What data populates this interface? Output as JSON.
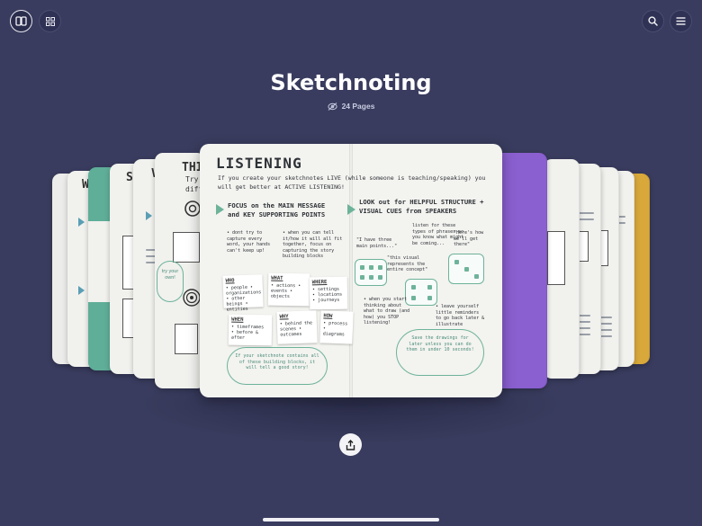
{
  "toolbar": {
    "left": [
      {
        "icon": "book-icon"
      },
      {
        "icon": "grid-icon"
      }
    ],
    "right": [
      {
        "icon": "search-icon"
      },
      {
        "icon": "menu-icon"
      }
    ]
  },
  "notebook": {
    "title": "Sketchnoting",
    "page_count_label": "24 Pages",
    "page_count_icon": "hidden-eye-icon"
  },
  "spread": {
    "title": "LISTENING",
    "intro": "If you create your sketchnotes LIVE (while someone is teaching/speaking) you will get better at ACTIVE LISTENING!",
    "left_heading": "FOCUS on the MAIN MESSAGE and KEY SUPPORTING POINTS",
    "left_note_1": "• dont try to capture every word, your hands can't keep up!",
    "left_note_2": "• when you can tell it/how it will all fit together, focus on capturing the story building blocks",
    "cards": [
      {
        "title": "WHO",
        "text": "• people • organizations • other beings • entities"
      },
      {
        "title": "WHAT",
        "text": "• actions • events • objects"
      },
      {
        "title": "WHERE",
        "text": "• settings • locations • journeys"
      },
      {
        "title": "WHEN",
        "text": "• timeframes • before & after"
      },
      {
        "title": "WHY",
        "text": "• behind the scenes • outcomes"
      },
      {
        "title": "HOW",
        "text": "• process • diagrams"
      }
    ],
    "left_cloud": "If your sketchnote contains all of these building blocks, it will tell a good story!",
    "right_heading": "LOOK out for HELPFUL STRUCTURE + VISUAL CUES from SPEAKERS",
    "right_note_1": "listen for these types of phrases so you know what might be coming...",
    "right_quote_1": "\"I have three main points...\"",
    "right_quote_2": "\"Here's how we'll get there\"",
    "right_quote_3": "\"this visual represents the entire concept\"",
    "right_note_2": "• when you start thinking about what to draw (and how) you STOP listening!",
    "right_note_3": "• leave yourself little reminders to go back later & illustrate",
    "right_cloud": "Save the drawings for later unless you can do them in under 10 seconds!"
  },
  "back_pages": {
    "p1_label": "W",
    "p2_label": "S",
    "p3_label": "V",
    "p4_label": "THI",
    "p4_sub": "Try",
    "p4_sub2": "diff",
    "p4_note": "try your own!"
  },
  "actions": {
    "share_icon": "share-icon"
  },
  "colors": {
    "background": "#393c5e",
    "accent_green": "#6db39a",
    "accent_purple": "#8a5fd0",
    "accent_gold": "#d8a83a",
    "accent_teal": "#5fae98"
  }
}
